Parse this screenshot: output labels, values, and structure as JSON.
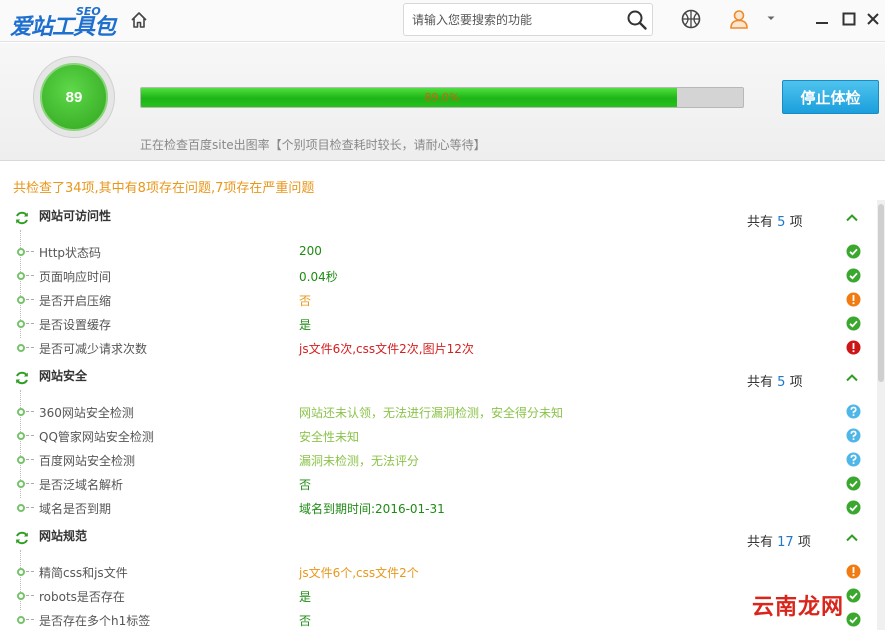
{
  "app": {
    "logo_main": "爱站工具包",
    "logo_seo": "SEO"
  },
  "search": {
    "placeholder": "请输入您要搜索的功能"
  },
  "header": {
    "score": "89",
    "progress_percent": 89.0,
    "progress_label": "89.0%",
    "stop_button": "停止体检",
    "status": "正在检查百度site出图率【个别项目检查耗时较长，请耐心等待】"
  },
  "summary": "共检查了34项,其中有8项存在问题,7项存在严重问题",
  "sections": [
    {
      "title": "网站可访问性",
      "count_prefix": "共有",
      "count": "5",
      "count_suffix": "项",
      "items": [
        {
          "label": "Http状态码",
          "value": "200",
          "status": "ok"
        },
        {
          "label": "页面响应时间",
          "value": "0.04秒",
          "status": "ok"
        },
        {
          "label": "是否开启压缩",
          "value": "否",
          "status": "warn"
        },
        {
          "label": "是否设置缓存",
          "value": "是",
          "status": "ok"
        },
        {
          "label": "是否可减少请求次数",
          "value": "js文件6次,css文件2次,图片12次",
          "status": "err"
        }
      ]
    },
    {
      "title": "网站安全",
      "count_prefix": "共有",
      "count": "5",
      "count_suffix": "项",
      "items": [
        {
          "label": "360网站安全检测",
          "value": "网站还未认领，无法进行漏洞检测，安全得分未知",
          "status": "info"
        },
        {
          "label": "QQ管家网站安全检测",
          "value": "安全性未知",
          "status": "info"
        },
        {
          "label": "百度网站安全检测",
          "value": "漏洞未检测，无法评分",
          "status": "info"
        },
        {
          "label": "是否泛域名解析",
          "value": "否",
          "status": "ok"
        },
        {
          "label": "域名是否到期",
          "value": "域名到期时间:2016-01-31",
          "status": "ok"
        }
      ]
    },
    {
      "title": "网站规范",
      "count_prefix": "共有",
      "count": "17",
      "count_suffix": "项",
      "items": [
        {
          "label": "精简css和js文件",
          "value": "js文件6个,css文件2个",
          "status": "warn"
        },
        {
          "label": "robots是否存在",
          "value": "是",
          "status": "ok"
        },
        {
          "label": "是否存在多个h1标签",
          "value": "否",
          "status": "ok"
        }
      ]
    }
  ],
  "watermark": "云南龙网",
  "colors": {
    "ok": "#3aa72e",
    "warn": "#ef7b12",
    "err": "#cc1515",
    "info": "#4fb6e8",
    "accent": "#1b9fdc"
  },
  "icons": [
    "home-icon",
    "search-icon",
    "basketball-icon",
    "user-icon",
    "dropdown-arrow-icon",
    "minimize-icon",
    "maximize-icon",
    "close-icon",
    "refresh-icon",
    "chevron-up-icon",
    "check-icon",
    "exclamation-icon",
    "question-icon"
  ]
}
